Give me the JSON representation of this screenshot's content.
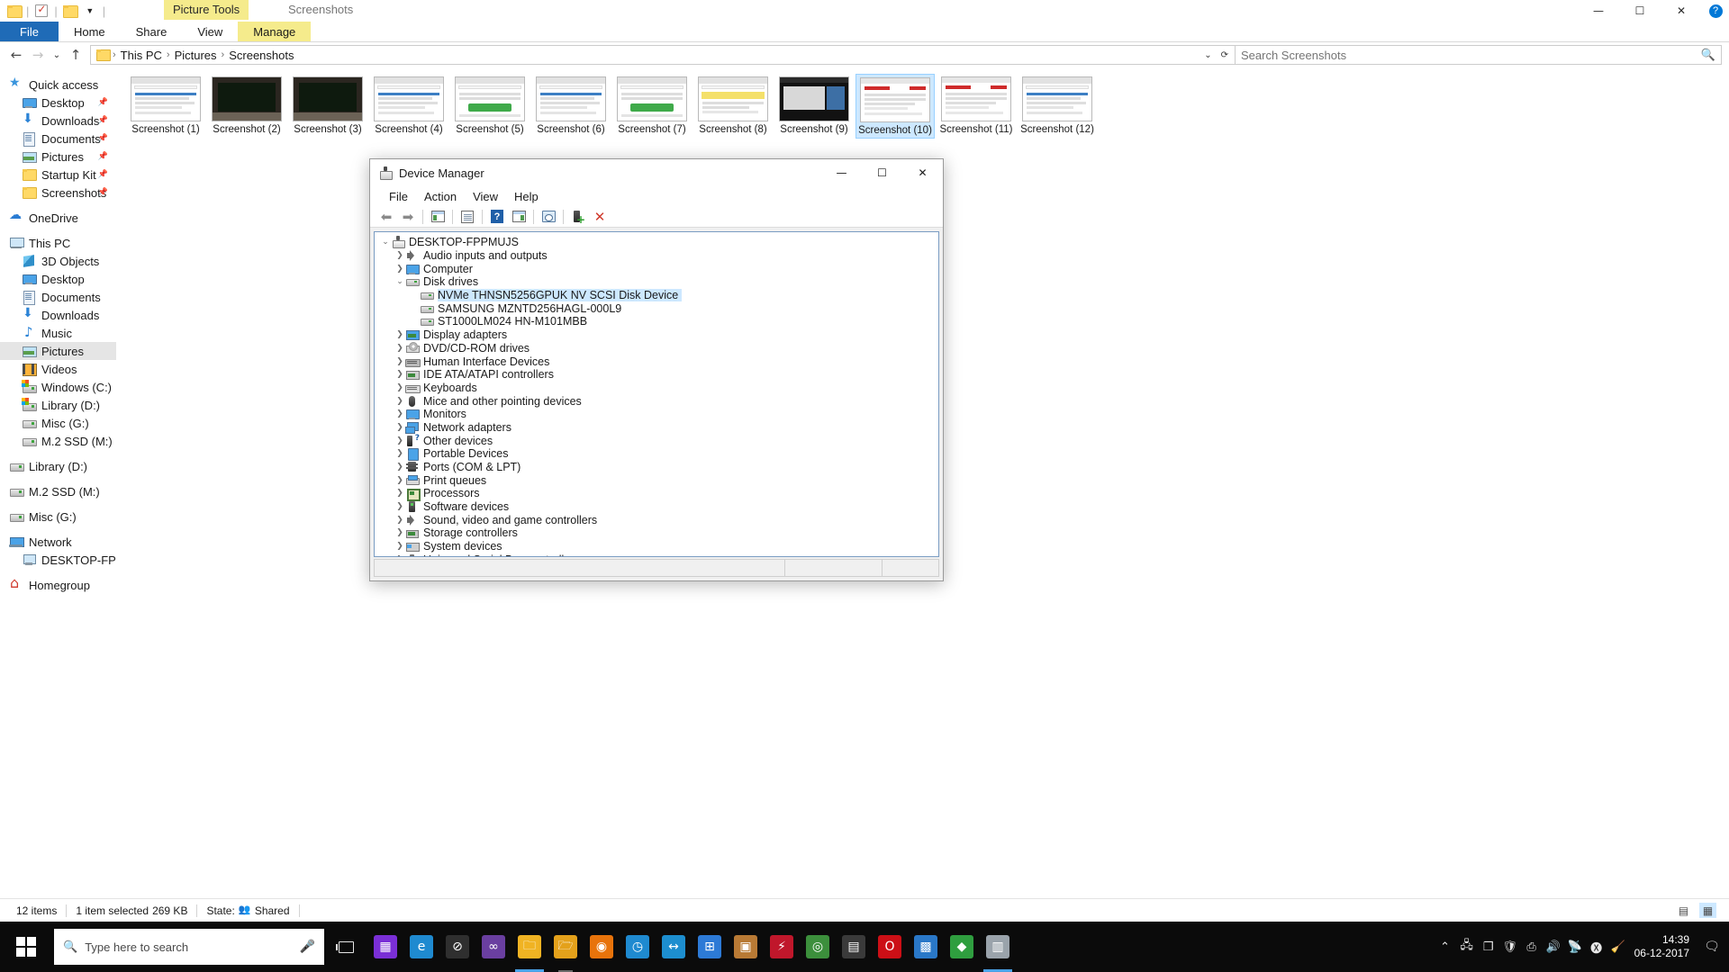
{
  "explorer": {
    "window_title": "Screenshots",
    "contextual_tab_group": "Picture Tools",
    "quick_access_toolbar": [
      {
        "name": "folder-icon",
        "label": "Properties"
      },
      {
        "name": "checkbox-icon",
        "label": "Checkbox"
      },
      {
        "name": "folder-icon",
        "label": "New folder"
      },
      {
        "name": "chevron-down-icon",
        "label": "Customize Quick Access Toolbar"
      }
    ],
    "window_buttons": {
      "minimize": "—",
      "maximize": "☐",
      "close": "✕",
      "help": "?"
    },
    "ribbon_tabs": [
      {
        "label": "File",
        "kind": "file"
      },
      {
        "label": "Home",
        "kind": "normal"
      },
      {
        "label": "Share",
        "kind": "normal"
      },
      {
        "label": "View",
        "kind": "normal"
      },
      {
        "label": "Manage",
        "kind": "contextual"
      }
    ],
    "address_bar": {
      "back": "←",
      "forward": "→",
      "recent": "⌄",
      "up": "↑",
      "breadcrumbs": [
        "This PC",
        "Pictures",
        "Screenshots"
      ],
      "separator": "›",
      "dropdown": "⌄",
      "refresh": "⟳"
    },
    "search": {
      "placeholder": "Search Screenshots",
      "value": "",
      "icon": "search-icon"
    },
    "nav_pane": [
      {
        "label": "Quick access",
        "icon": "star-icon",
        "indent": 0,
        "pinned": false,
        "selected": false
      },
      {
        "label": "Desktop",
        "icon": "monitor-icon",
        "indent": 1,
        "pinned": true,
        "selected": false
      },
      {
        "label": "Downloads",
        "icon": "download-icon",
        "indent": 1,
        "pinned": true,
        "selected": false
      },
      {
        "label": "Documents",
        "icon": "document-icon",
        "indent": 1,
        "pinned": true,
        "selected": false
      },
      {
        "label": "Pictures",
        "icon": "pictures-icon",
        "indent": 1,
        "pinned": true,
        "selected": false
      },
      {
        "label": "Startup Kit",
        "icon": "folder-icon",
        "indent": 1,
        "pinned": true,
        "selected": false
      },
      {
        "label": "Screenshots",
        "icon": "folder-icon",
        "indent": 1,
        "pinned": true,
        "selected": false
      },
      {
        "gap": true
      },
      {
        "label": "OneDrive",
        "icon": "onedrive-icon",
        "indent": 0,
        "pinned": false,
        "selected": false
      },
      {
        "gap": true
      },
      {
        "label": "This PC",
        "icon": "this-pc-icon",
        "indent": 0,
        "pinned": false,
        "selected": false
      },
      {
        "label": "3D Objects",
        "icon": "3d-objects-icon",
        "indent": 1,
        "pinned": false,
        "selected": false
      },
      {
        "label": "Desktop",
        "icon": "monitor-icon",
        "indent": 1,
        "pinned": false,
        "selected": false
      },
      {
        "label": "Documents",
        "icon": "document-icon",
        "indent": 1,
        "pinned": false,
        "selected": false
      },
      {
        "label": "Downloads",
        "icon": "download-icon",
        "indent": 1,
        "pinned": false,
        "selected": false
      },
      {
        "label": "Music",
        "icon": "music-icon",
        "indent": 1,
        "pinned": false,
        "selected": false
      },
      {
        "label": "Pictures",
        "icon": "pictures-icon",
        "indent": 1,
        "pinned": false,
        "selected": true
      },
      {
        "label": "Videos",
        "icon": "videos-icon",
        "indent": 1,
        "pinned": false,
        "selected": false
      },
      {
        "label": "Windows (C:)",
        "icon": "windows-drive-icon",
        "indent": 1,
        "pinned": false,
        "selected": false
      },
      {
        "label": "Library (D:)",
        "icon": "windows-drive-icon",
        "indent": 1,
        "pinned": false,
        "selected": false
      },
      {
        "label": "Misc (G:)",
        "icon": "drive-icon",
        "indent": 1,
        "pinned": false,
        "selected": false
      },
      {
        "label": "M.2 SSD (M:)",
        "icon": "drive-icon",
        "indent": 1,
        "pinned": false,
        "selected": false
      },
      {
        "gap": true
      },
      {
        "label": "Library (D:)",
        "icon": "drive-icon",
        "indent": 0,
        "pinned": false,
        "selected": false
      },
      {
        "gap": true
      },
      {
        "label": "M.2 SSD (M:)",
        "icon": "drive-icon",
        "indent": 0,
        "pinned": false,
        "selected": false
      },
      {
        "gap": true
      },
      {
        "label": "Misc (G:)",
        "icon": "drive-icon",
        "indent": 0,
        "pinned": false,
        "selected": false
      },
      {
        "gap": true
      },
      {
        "label": "Network",
        "icon": "network-icon",
        "indent": 0,
        "pinned": false,
        "selected": false
      },
      {
        "label": "DESKTOP-FPPMUJS",
        "icon": "computer-icon",
        "indent": 1,
        "pinned": false,
        "selected": false
      },
      {
        "gap": true
      },
      {
        "label": "Homegroup",
        "icon": "homegroup-icon",
        "indent": 0,
        "pinned": false,
        "selected": false
      }
    ],
    "files": [
      {
        "label": "Screenshot (1)",
        "selected": false,
        "style": "browser-light"
      },
      {
        "label": "Screenshot (2)",
        "selected": false,
        "style": "dark-photo"
      },
      {
        "label": "Screenshot (3)",
        "selected": false,
        "style": "dark-photo"
      },
      {
        "label": "Screenshot (4)",
        "selected": false,
        "style": "browser-light"
      },
      {
        "label": "Screenshot (5)",
        "selected": false,
        "style": "browser-green"
      },
      {
        "label": "Screenshot (6)",
        "selected": false,
        "style": "browser-light"
      },
      {
        "label": "Screenshot (7)",
        "selected": false,
        "style": "browser-green"
      },
      {
        "label": "Screenshot (8)",
        "selected": false,
        "style": "browser-yellow"
      },
      {
        "label": "Screenshot (9)",
        "selected": false,
        "style": "dark-app"
      },
      {
        "label": "Screenshot (10)",
        "selected": true,
        "style": "browser-red"
      },
      {
        "label": "Screenshot (11)",
        "selected": false,
        "style": "browser-red"
      },
      {
        "label": "Screenshot (12)",
        "selected": false,
        "style": "browser-light"
      }
    ],
    "status_bar": {
      "item_count": "12 items",
      "selection": "1 item selected",
      "size": "269 KB",
      "state_label": "State:",
      "state_value": "Shared",
      "view_details_icon": "details-view-icon",
      "view_tiles_icon": "large-icons-view-icon"
    }
  },
  "device_manager": {
    "title": "Device Manager",
    "title_icon": "device-manager-icon",
    "window_buttons": {
      "minimize": "—",
      "maximize": "☐",
      "close": "✕"
    },
    "menu": [
      "File",
      "Action",
      "View",
      "Help"
    ],
    "toolbar": [
      {
        "name": "back-icon",
        "label": "Back"
      },
      {
        "name": "forward-icon",
        "label": "Forward"
      },
      {
        "name": "show-hide-console-tree-icon",
        "label": "Show/Hide Console Tree"
      },
      {
        "name": "properties-icon",
        "label": "Properties"
      },
      {
        "name": "help-icon",
        "label": "Help"
      },
      {
        "name": "show-hide-action-pane-icon",
        "label": "Show/Hide Action Pane"
      },
      {
        "name": "scan-for-hardware-changes-icon",
        "label": "Scan for hardware changes"
      },
      {
        "name": "update-driver-icon",
        "label": "Update driver"
      },
      {
        "name": "uninstall-device-icon",
        "label": "Uninstall device"
      }
    ],
    "tree": [
      {
        "label": "DESKTOP-FPPMUJS",
        "level": 0,
        "state": "expanded",
        "icon": "computer-icon",
        "selected": false
      },
      {
        "label": "Audio inputs and outputs",
        "level": 1,
        "state": "collapsed",
        "icon": "audio-icon",
        "selected": false
      },
      {
        "label": "Computer",
        "level": 1,
        "state": "collapsed",
        "icon": "computer-monitor-icon",
        "selected": false
      },
      {
        "label": "Disk drives",
        "level": 1,
        "state": "expanded",
        "icon": "disk-drive-icon",
        "selected": false
      },
      {
        "label": "NVMe THNSN5256GPUK NV SCSI Disk Device",
        "level": 2,
        "state": "leaf",
        "icon": "disk-drive-icon",
        "selected": true
      },
      {
        "label": "SAMSUNG MZNTD256HAGL-000L9",
        "level": 2,
        "state": "leaf",
        "icon": "disk-drive-icon",
        "selected": false
      },
      {
        "label": "ST1000LM024 HN-M101MBB",
        "level": 2,
        "state": "leaf",
        "icon": "disk-drive-icon",
        "selected": false
      },
      {
        "label": "Display adapters",
        "level": 1,
        "state": "collapsed",
        "icon": "display-adapter-icon",
        "selected": false
      },
      {
        "label": "DVD/CD-ROM drives",
        "level": 1,
        "state": "collapsed",
        "icon": "dvd-drive-icon",
        "selected": false
      },
      {
        "label": "Human Interface Devices",
        "level": 1,
        "state": "collapsed",
        "icon": "hid-icon",
        "selected": false
      },
      {
        "label": "IDE ATA/ATAPI controllers",
        "level": 1,
        "state": "collapsed",
        "icon": "ide-controller-icon",
        "selected": false
      },
      {
        "label": "Keyboards",
        "level": 1,
        "state": "collapsed",
        "icon": "keyboard-icon",
        "selected": false
      },
      {
        "label": "Mice and other pointing devices",
        "level": 1,
        "state": "collapsed",
        "icon": "mouse-icon",
        "selected": false
      },
      {
        "label": "Monitors",
        "level": 1,
        "state": "collapsed",
        "icon": "monitor-icon",
        "selected": false
      },
      {
        "label": "Network adapters",
        "level": 1,
        "state": "collapsed",
        "icon": "network-adapter-icon",
        "selected": false
      },
      {
        "label": "Other devices",
        "level": 1,
        "state": "collapsed",
        "icon": "other-devices-icon",
        "selected": false
      },
      {
        "label": "Portable Devices",
        "level": 1,
        "state": "collapsed",
        "icon": "portable-device-icon",
        "selected": false
      },
      {
        "label": "Ports (COM & LPT)",
        "level": 1,
        "state": "collapsed",
        "icon": "ports-icon",
        "selected": false
      },
      {
        "label": "Print queues",
        "level": 1,
        "state": "collapsed",
        "icon": "printer-icon",
        "selected": false
      },
      {
        "label": "Processors",
        "level": 1,
        "state": "collapsed",
        "icon": "processor-icon",
        "selected": false
      },
      {
        "label": "Software devices",
        "level": 1,
        "state": "collapsed",
        "icon": "software-device-icon",
        "selected": false
      },
      {
        "label": "Sound, video and game controllers",
        "level": 1,
        "state": "collapsed",
        "icon": "audio-icon",
        "selected": false
      },
      {
        "label": "Storage controllers",
        "level": 1,
        "state": "collapsed",
        "icon": "storage-controller-icon",
        "selected": false
      },
      {
        "label": "System devices",
        "level": 1,
        "state": "collapsed",
        "icon": "system-device-icon",
        "selected": false
      },
      {
        "label": "Universal Serial Bus controllers",
        "level": 1,
        "state": "collapsed",
        "icon": "usb-controller-icon",
        "selected": false
      }
    ]
  },
  "taskbar": {
    "start_label": "Start",
    "search_placeholder": "Type here to search",
    "search_value": "",
    "cortana_icon": "microphone-icon",
    "task_view_icon": "task-view-icon",
    "apps": [
      {
        "name": "store-icon",
        "color": "#7a2fd6",
        "glyph": "▦",
        "state": "none"
      },
      {
        "name": "edge-icon",
        "color": "#1f8ad0",
        "glyph": "e",
        "state": "none"
      },
      {
        "name": "no-entry-icon",
        "color": "#2f2f2f",
        "glyph": "⊘",
        "state": "none"
      },
      {
        "name": "visual-studio-icon",
        "color": "#6a3fa0",
        "glyph": "∞",
        "state": "none"
      },
      {
        "name": "file-explorer-icon",
        "color": "#f0b323",
        "glyph": "🗀",
        "state": "active"
      },
      {
        "name": "folder-app-icon",
        "color": "#e4a11b",
        "glyph": "🗁",
        "state": "running"
      },
      {
        "name": "firefox-icon",
        "color": "#e8730b",
        "glyph": "◉",
        "state": "none"
      },
      {
        "name": "clock-icon",
        "color": "#1f8ad0",
        "glyph": "◷",
        "state": "none"
      },
      {
        "name": "teamviewer-icon",
        "color": "#1d8ecf",
        "glyph": "↔",
        "state": "none"
      },
      {
        "name": "apps-grid-icon",
        "color": "#2d7ad6",
        "glyph": "⊞",
        "state": "none"
      },
      {
        "name": "package-icon",
        "color": "#b97a35",
        "glyph": "▣",
        "state": "none"
      },
      {
        "name": "flash-icon",
        "color": "#c0172b",
        "glyph": "⚡",
        "state": "none"
      },
      {
        "name": "chrome-icon",
        "color": "#3c8f3c",
        "glyph": "◎",
        "state": "none"
      },
      {
        "name": "calculator-icon",
        "color": "#3a3a3a",
        "glyph": "▤",
        "state": "none"
      },
      {
        "name": "opera-icon",
        "color": "#cc0f16",
        "glyph": "O",
        "state": "none"
      },
      {
        "name": "photos-icon",
        "color": "#2a78c8",
        "glyph": "▩",
        "state": "none"
      },
      {
        "name": "green-app-icon",
        "color": "#2f9e3f",
        "glyph": "◆",
        "state": "none"
      },
      {
        "name": "device-manager-taskbar-icon",
        "color": "#9aa3ab",
        "glyph": "▥",
        "state": "active"
      }
    ],
    "tray": {
      "show_hidden_icons": "chevron-up-icon",
      "icons": [
        "network-icon",
        "copy-icon",
        "security-warning-icon",
        "safely-remove-hardware-icon",
        "volume-icon",
        "satellite-icon",
        "xfire-icon",
        "ccleaner-icon"
      ],
      "time": "14:39",
      "date": "06-12-2017",
      "action_center_icon": "action-center-icon"
    }
  }
}
